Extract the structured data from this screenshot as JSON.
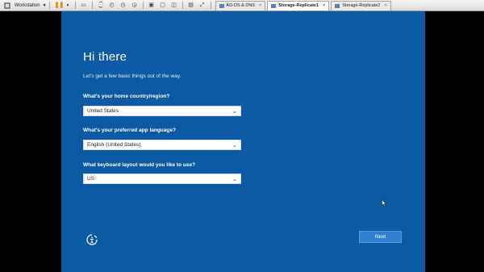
{
  "toolbar": {
    "product_label": "Workstation",
    "icons": [
      "workstation-logo-icon",
      "pause-icon",
      "vm-settings-icon",
      "send-ctrl-alt-del-icon",
      "snapshot-icon",
      "revert-snapshot-icon",
      "manage-snapshots-icon",
      "view-icon",
      "fullscreen-icon",
      "unity-icon",
      "console-view-icon",
      "thumbnail-icon"
    ],
    "tabs": [
      {
        "label": "AD-DS & DNS",
        "active": false
      },
      {
        "label": "Storage-Replicate1",
        "active": true
      },
      {
        "label": "Storage-Replicate2",
        "active": false
      }
    ],
    "close_glyph": "×"
  },
  "setup": {
    "title": "Hi there",
    "subtitle": "Let's get a few basic things out of the way.",
    "country_label": "What's your home country/region?",
    "country_value": "United States",
    "language_label": "What's your preferred app language?",
    "language_value": "English (United States)",
    "keyboard_label": "What keyboard layout would you like to use?",
    "keyboard_value": "US",
    "next_label": "Next"
  },
  "colors": {
    "background": "#0b5aa3",
    "next_button": "#2f80d2",
    "toolbar": "#e4e4e4"
  }
}
